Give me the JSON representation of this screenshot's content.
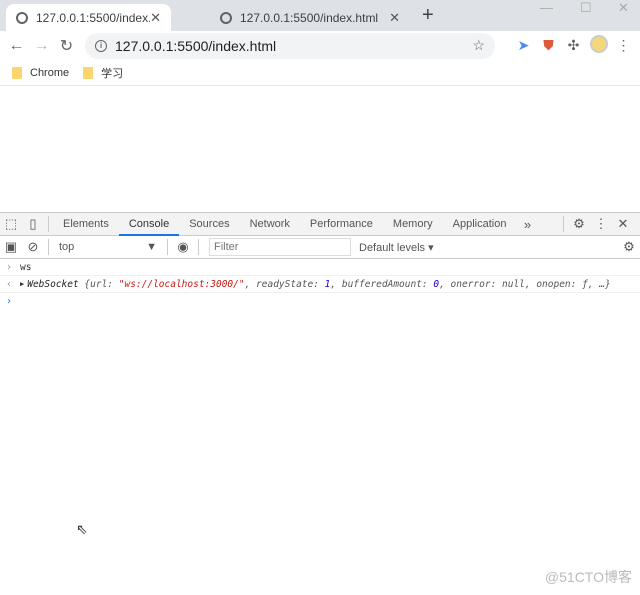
{
  "browser": {
    "tabs": [
      {
        "title": "127.0.0.1:5500/index.html",
        "active": true
      },
      {
        "title": "127.0.0.1:5500/index.html",
        "active": false
      }
    ],
    "url": "127.0.0.1:5500/index.html",
    "bookmarks": [
      "Chrome",
      "学习"
    ]
  },
  "devtools": {
    "tabs": [
      "Elements",
      "Console",
      "Sources",
      "Network",
      "Performance",
      "Memory",
      "Application"
    ],
    "selected_tab": "Console",
    "context": "top",
    "filter_placeholder": "Filter",
    "levels": "Default levels ▾",
    "console": {
      "input": "ws",
      "result_class": "WebSocket",
      "result_open": " {url: ",
      "result_url": "\"ws://localhost:3000/\"",
      "result_rs_key": ", readyState: ",
      "result_rs": "1",
      "result_ba_key": ", bufferedAmount: ",
      "result_ba": "0",
      "result_rest": ", onerror: null, onopen: ƒ, …}"
    }
  },
  "watermark": "@51CTO博客"
}
